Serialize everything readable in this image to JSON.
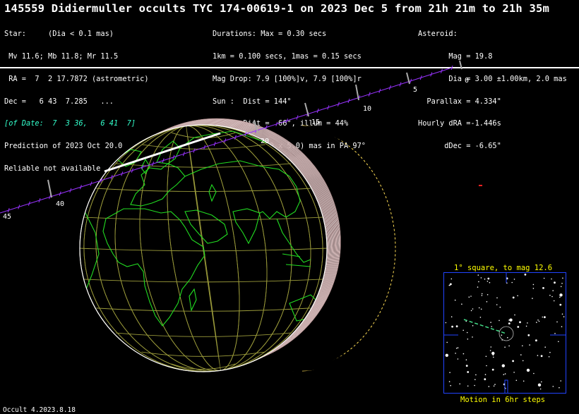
{
  "title": "145559 Didiermuller occults TYC 174-00619-1 on 2023 Dec  5 from 21h 21m to 21h 35m",
  "star": {
    "lines": [
      "Star:     (Dia < 0.1 mas)",
      " Mv 11.6; Mb 11.8; Mr 11.5",
      " RA =  7  2 17.7872 (astrometric)",
      "Dec =   6 43  7.285   ...",
      "[of Date:  7  3 36,   6 41  7]",
      "Prediction of 2023 Oct 20.0",
      "Reliable not available"
    ]
  },
  "event": {
    "lines": [
      "Durations: Max = 0.30 secs",
      "1km = 0.100 secs, 1mas = 0.15 secs",
      "Mag Drop: 7.9 [100%]v, 7.9 [100%]r",
      "Sun :  Dist = 144°",
      "Moon:  Dist =  66°, illum = 44%",
      "1σ Err: ±(37.0 x 5.0) mas in PA 97°"
    ]
  },
  "asteroid": {
    "lines": [
      "Asteroid:",
      "       Mag = 19.8",
      "       Dia = 3.00 ±1.00km, 2.0 mas",
      "  Parallax = 4.334\"",
      "Hourly dRA =-1.446s",
      "      dDec = -6.65\""
    ]
  },
  "track_labels": [
    "0",
    "5",
    "10",
    "15",
    "20",
    "40",
    "45"
  ],
  "inset": {
    "title": "1° square, to mag 12.6",
    "caption": "Motion in 6hr steps"
  },
  "footer": "Occult 4.2023.8.18",
  "colors": {
    "grid": "#9a9a3a",
    "coast": "#22dd22",
    "track": "#9933ff",
    "path": "#ffffff",
    "limb": "#ffdd55",
    "inset_border": "#2244ff"
  }
}
